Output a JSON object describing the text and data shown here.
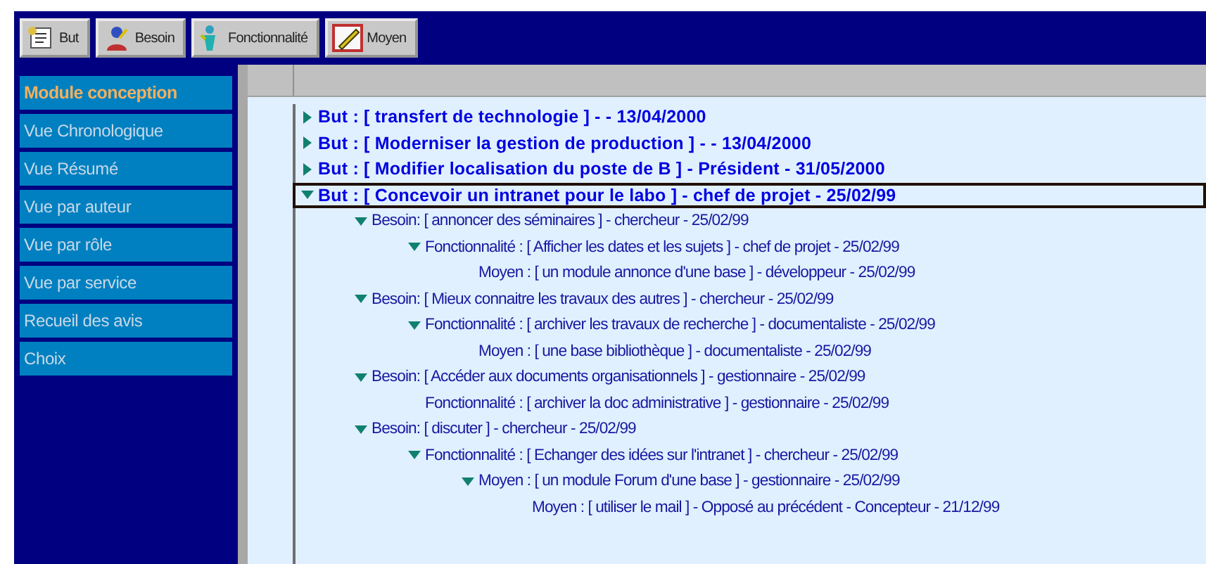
{
  "toolbar": [
    {
      "label": "But",
      "kind": "goal"
    },
    {
      "label": "Besoin",
      "kind": "need"
    },
    {
      "label": "Fonctionnalité",
      "kind": "feature"
    },
    {
      "label": "Moyen",
      "kind": "means"
    }
  ],
  "sidebar": {
    "title": "Module conception",
    "items": [
      "Vue Chronologique",
      "Vue Résumé",
      "Vue par auteur",
      "Vue par rôle",
      "Vue par service",
      "Recueil des avis",
      "Choix"
    ]
  },
  "tree": [
    {
      "text": "But  : [ transfert de technologie  ]  -   - 13/04/2000",
      "kind": "node",
      "expanded": false,
      "selected": false
    },
    {
      "text": "But  : [ Moderniser la gestion de production  ]  -   - 13/04/2000",
      "kind": "node",
      "expanded": false,
      "selected": false
    },
    {
      "text": "But  : [ Modifier localisation du poste de B ]  -  Président - 31/05/2000",
      "kind": "node",
      "expanded": false,
      "selected": false
    },
    {
      "text": "But  : [ Concevoir un intranet pour le labo ]  -   chef de projet - 25/02/99",
      "kind": "node",
      "expanded": true,
      "selected": true,
      "children": [
        {
          "text": "Besoin: [ annoncer des séminaires ] - chercheur - 25/02/99",
          "kind": "node",
          "expanded": true,
          "children": [
            {
              "text": "Fonctionnalité  : [ Afficher les dates et les sujets ]  -  chef de projet - 25/02/99",
              "kind": "node",
              "expanded": true,
              "children": [
                {
                  "text": "Moyen : [ un module annonce d'une base ]  -  développeur - 25/02/99",
                  "kind": "leaf"
                }
              ]
            }
          ]
        },
        {
          "text": "Besoin: [ Mieux connaitre les travaux des autres ]  -  chercheur - 25/02/99",
          "kind": "node",
          "expanded": true,
          "children": [
            {
              "text": "Fonctionnalité  : [ archiver les travaux de recherche ]  -  documentaliste - 25/02/99",
              "kind": "node",
              "expanded": true,
              "children": [
                {
                  "text": "Moyen : [ une base bibliothèque ]  -  documentaliste - 25/02/99",
                  "kind": "leaf"
                }
              ]
            }
          ]
        },
        {
          "text": "Besoin: [ Accéder aux documents organisationnels ]  -  gestionnaire - 25/02/99",
          "kind": "node",
          "expanded": true,
          "children": [
            {
              "text": "Fonctionnalité  : [ archiver la doc administrative ]  -  gestionnaire - 25/02/99",
              "kind": "leaf"
            }
          ]
        },
        {
          "text": "Besoin: [ discuter ]  -  chercheur - 25/02/99",
          "kind": "node",
          "expanded": true,
          "children": [
            {
              "text": "Fonctionnalité  : [ Echanger des idées sur l'intranet ]  -  chercheur - 25/02/99",
              "kind": "node",
              "expanded": true,
              "children": [
                {
                  "text": "Moyen : [ un module Forum d'une base ]  -  gestionnaire - 25/02/99",
                  "kind": "node",
                  "expanded": true,
                  "children": [
                    {
                      "text": "Moyen : [ utiliser le mail ] -  Opposé au précédent  -  Concepteur - 21/12/99",
                      "kind": "leaf"
                    }
                  ]
                }
              ]
            }
          ]
        }
      ]
    }
  ]
}
